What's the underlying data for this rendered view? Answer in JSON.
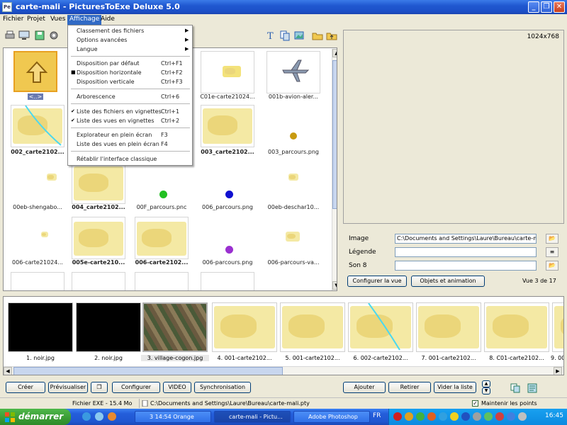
{
  "window": {
    "title": "carte-mali - PicturesToExe Deluxe 5.0"
  },
  "menubar": [
    {
      "label": "Fichier"
    },
    {
      "label": "Projet"
    },
    {
      "label": "Vues"
    },
    {
      "label": "Affichage"
    },
    {
      "label": "Aide"
    }
  ],
  "affichage_menu": {
    "items": [
      {
        "label": "Classement des fichiers",
        "submenu": true
      },
      {
        "label": "Options avancées",
        "submenu": true
      },
      {
        "label": "Langue",
        "submenu": true
      },
      {
        "label": "Disposition par défaut",
        "shortcut": "Ctrl+F1"
      },
      {
        "label": "Disposition horizontale",
        "shortcut": "Ctrl+F2",
        "checked": true
      },
      {
        "label": "Disposition verticale",
        "shortcut": "Ctrl+F3"
      },
      {
        "label": "Arborescence",
        "shortcut": "Ctrl+6"
      },
      {
        "label": "Liste des fichiers en vignettes",
        "shortcut": "Ctrl+1",
        "checked": true
      },
      {
        "label": "Liste des vues en vignettes",
        "shortcut": "Ctrl+2",
        "checked": true
      },
      {
        "label": "Explorateur en plein écran",
        "shortcut": "F3"
      },
      {
        "label": "Liste des vues en plein écran",
        "shortcut": "F4"
      },
      {
        "label": "Rétablir l'interface classique"
      }
    ]
  },
  "files": [
    {
      "label": "<..>"
    },
    {
      "label": ""
    },
    {
      "label": ""
    },
    {
      "label": "C01e-carte21024..."
    },
    {
      "label": "001b-avion-aler..."
    },
    {
      "label": "002_carte2102...",
      "bold": true
    },
    {
      "label": ""
    },
    {
      "label": ""
    },
    {
      "label": "003_carte2102...",
      "bold": true
    },
    {
      "label": "003_parcours.png"
    },
    {
      "label": "00eb-shengabo..."
    },
    {
      "label": "004_carte2102...",
      "bold": true
    },
    {
      "label": "00F_parcours.pnc"
    },
    {
      "label": "006_parcours.png"
    },
    {
      "label": "00eb-deschar10..."
    },
    {
      "label": "006-carte21024..."
    },
    {
      "label": "005e-carte210...",
      "bold": true
    },
    {
      "label": "006-carte2102...",
      "bold": true
    },
    {
      "label": "006-parcours.png"
    },
    {
      "label": "006-parcours-va..."
    }
  ],
  "preview": {
    "resolution": "1024x768"
  },
  "properties": {
    "image_label": "Image",
    "image_value": "C:\\Documents and Settings\\Laure\\Bureau\\carte-mali.ptt",
    "legend_label": "Légende",
    "legend_value": "",
    "sound_label": "Son 8",
    "sound_value": "",
    "configure_view": "Configurer la vue",
    "objects_animation": "Objets et animation",
    "view_count": "Vue 3 de 17"
  },
  "film": [
    {
      "label": "1. noir.jpg"
    },
    {
      "label": "2. noir.jpg"
    },
    {
      "label": "3. village-cogon.jpg",
      "selected": true
    },
    {
      "label": "4. 001-carte2102..."
    },
    {
      "label": "5. 001-carte2102..."
    },
    {
      "label": "6. 002-carte2102..."
    },
    {
      "label": "7. 001-carte2102..."
    },
    {
      "label": "8. C01-carte2102..."
    },
    {
      "label": "9. 00..."
    }
  ],
  "bottom_buttons": {
    "create": "Créer",
    "preview": "Prévisualiser",
    "configure": "Configurer",
    "video": "VIDEO",
    "sync": "Synchronisation",
    "add": "Ajouter",
    "remove": "Retirer",
    "empty": "Vider la liste"
  },
  "status": {
    "exe": "Fichier EXE - 15.4 Mo",
    "path": "C:\\Documents and Settings\\Laure\\Bureau\\carte-mali.pty",
    "keep_points": "Maintenir les points"
  },
  "taskbar": {
    "start": "démarrer",
    "tasks": [
      {
        "label": "3 14:54 Orange"
      },
      {
        "label": "carte-mali - Pictu..."
      },
      {
        "label": "Adobe Photoshop"
      }
    ],
    "lang": "FR",
    "clock": "16:45"
  }
}
